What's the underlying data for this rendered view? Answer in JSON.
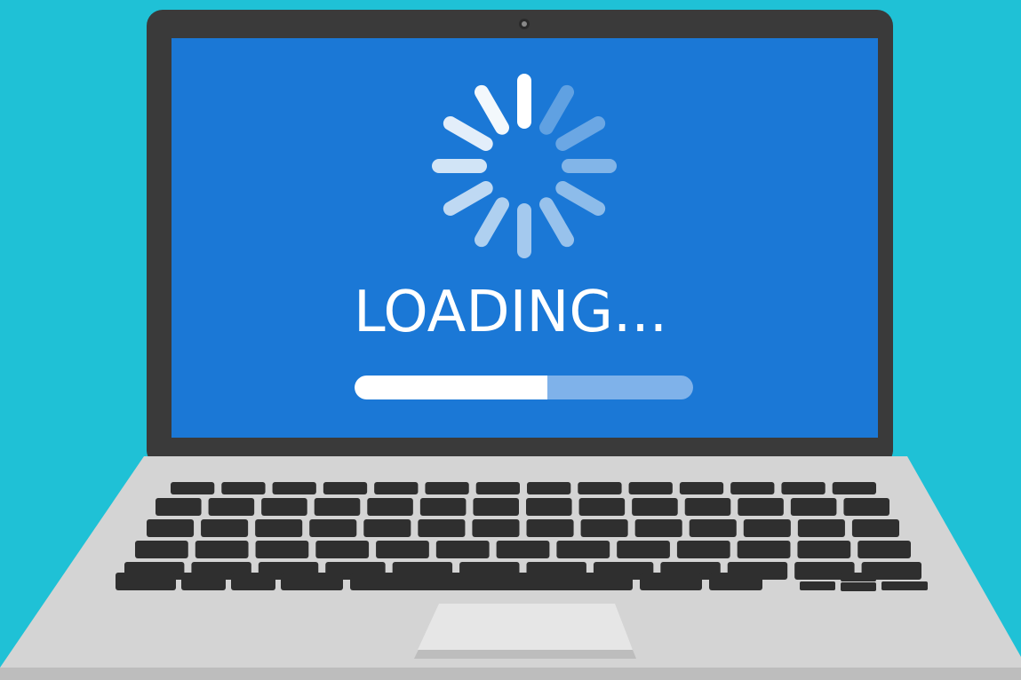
{
  "screen": {
    "status_text": "LOADING...",
    "progress_fraction": 0.57
  },
  "spinner": {
    "spoke_count": 12,
    "brightest_index": 0,
    "spoke_opacities": [
      1.0,
      0.3,
      0.35,
      0.45,
      0.5,
      0.55,
      0.6,
      0.65,
      0.72,
      0.8,
      0.88,
      0.95
    ]
  },
  "colors": {
    "background": "#1fc1d6",
    "screen": "#1b78d6",
    "bezel": "#3a3a3a",
    "base": "#d4d4d4",
    "base_edge": "#bdbdbd",
    "key": "#2f2f2f",
    "trackpad": "#e6e6e6",
    "progress_fill": "#ffffff",
    "progress_track": "#7fb2ea",
    "spinner": "#ffffff",
    "camera": "#8a8a8a"
  }
}
